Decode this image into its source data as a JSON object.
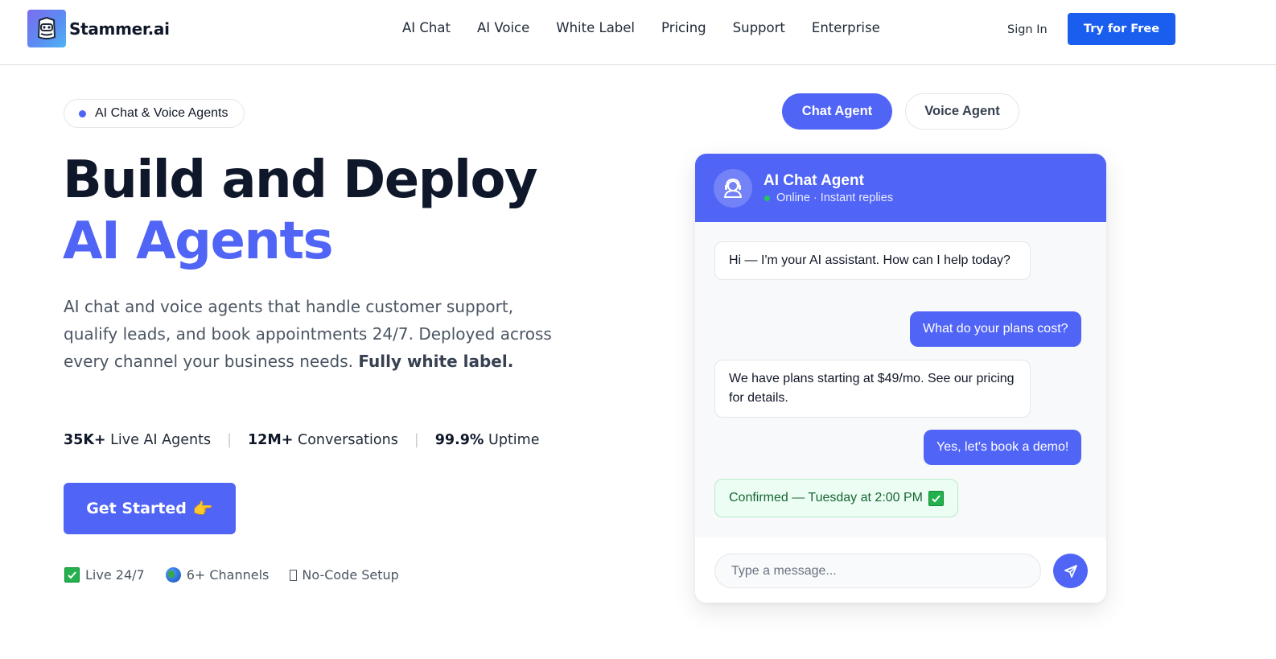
{
  "brand": {
    "name": "Stammer.ai",
    "logo_icon": "robot-face-icon",
    "accent": "#5064f6",
    "cta_blue": "#1a5ef0"
  },
  "nav": {
    "links": [
      "AI Chat",
      "AI Voice",
      "White Label",
      "Pricing",
      "Support",
      "Enterprise"
    ],
    "sign_in": "Sign In",
    "try_free": "Try for Free"
  },
  "hero": {
    "badge": "AI Chat & Voice Agents",
    "title_line1": "Build and Deploy",
    "title_line2": "AI Agents",
    "description": "AI chat and voice agents that handle customer support, qualify leads, and book appointments 24/7. Deployed across every channel your business needs.",
    "description_bold": "Fully white label.",
    "stats": [
      {
        "value": "35K+",
        "label": "Live AI Agents"
      },
      {
        "value": "12M+",
        "label": "Conversations"
      },
      {
        "value": "99.9%",
        "label": "Uptime"
      }
    ],
    "cta": "Get Started",
    "cta_icon": "pointing-hand-icon",
    "features": [
      {
        "icon": "check-mark-icon",
        "label": "Live 24/7"
      },
      {
        "icon": "globe-icon",
        "label": "6+ Channels"
      },
      {
        "icon": "missing-glyph-icon",
        "label": "No-Code Setup"
      }
    ]
  },
  "agent_toggle": {
    "chat": "Chat Agent",
    "voice": "Voice Agent",
    "active": "chat"
  },
  "chat": {
    "agent_name": "AI Chat Agent",
    "status": "Online · Instant replies",
    "status_color": "#22c55e",
    "messages": [
      {
        "from": "bot",
        "text": "Hi — I'm your AI assistant. How can I help today?"
      },
      {
        "from": "user",
        "text": "What do your plans cost?"
      },
      {
        "from": "bot",
        "text": "We have plans starting at $49/mo. See our pricing for details."
      },
      {
        "from": "user",
        "text": "Yes, let's book a demo!"
      },
      {
        "from": "system",
        "text": "Confirmed — Tuesday at 2:00 PM"
      }
    ],
    "input_placeholder": "Type a message...",
    "send_icon": "send-icon"
  }
}
